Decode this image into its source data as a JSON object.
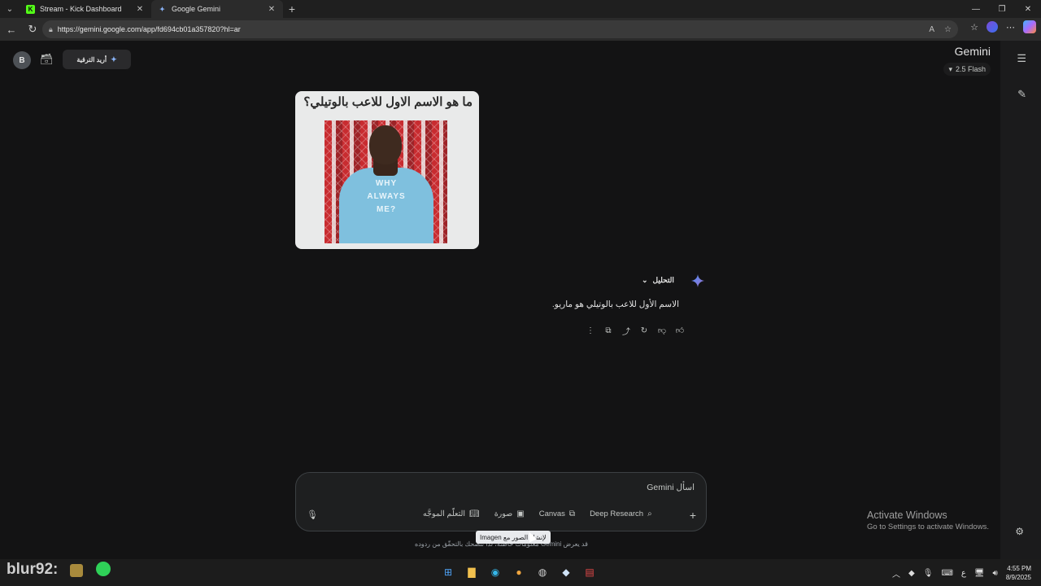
{
  "browser": {
    "tabs": [
      {
        "title": "Stream - Kick Dashboard",
        "favicon": "K"
      },
      {
        "title": "Google Gemini",
        "favicon": "gemini-star"
      }
    ],
    "url": "https://gemini.google.com/app/fd694cb01a357820?hl=ar"
  },
  "header": {
    "avatar_letter": "B",
    "upgrade_label": "أريد الترقية",
    "brand": "Gemini",
    "model": "2.5 Flash"
  },
  "conversation": {
    "image_question": "ما هو الاسم الاول للاعب بالوتيلي؟",
    "shirt_text": "WHY ALWAYS ME?",
    "analysis_label": "التحليل",
    "answer": "الاسم الأول للاعب بالوتيلي هو ماريو."
  },
  "input": {
    "placeholder": "اسأل Gemini",
    "tools": [
      {
        "label": "Deep Research",
        "icon": "deep-research-icon"
      },
      {
        "label": "Canvas",
        "icon": "canvas-icon"
      },
      {
        "label": "صورة",
        "icon": "image-icon"
      },
      {
        "label": "التعلّم الموجَّه",
        "icon": "book-icon"
      }
    ],
    "tooltip": "لإنشاء الصور مع Imagen",
    "disclaimer": "قد يعرض Gemini معلومات خاطئة، لذا ننصحك بالتحقّق من ردوده"
  },
  "watermark": {
    "line1": "Activate Windows",
    "line2": "Go to Settings to activate Windows."
  },
  "taskbar": {
    "overlay_name": "blur92:",
    "input_lang": "ع",
    "time": "4:55 PM",
    "date": "8/9/2025"
  },
  "colors": {
    "background": "#131314",
    "accent": "#8ab4f8",
    "kick_green": "#53fc18"
  }
}
